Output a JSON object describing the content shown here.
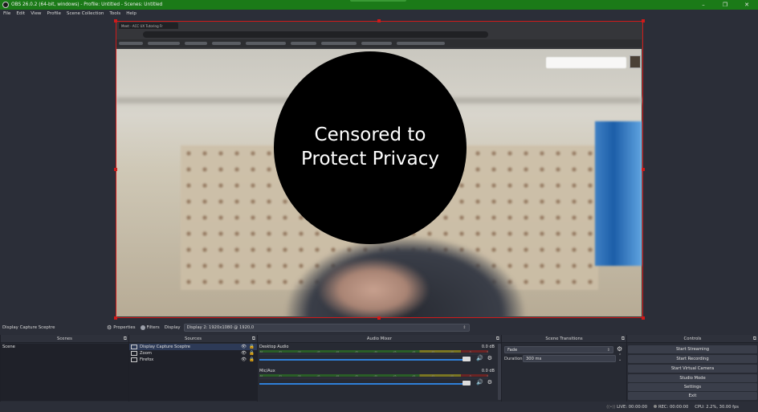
{
  "window": {
    "title": "OBS 26.0.2 (64-bit, windows) - Profile: Untitled - Scenes: Untitled",
    "minimize": "–",
    "maximize": "❐",
    "close": "✕"
  },
  "menu": [
    "File",
    "Edit",
    "View",
    "Profile",
    "Scene Collection",
    "Tools",
    "Help"
  ],
  "preview": {
    "browser_tab": "Meet - ACC UX Tutoring Fr",
    "censor_line1": "Censored to",
    "censor_line2": "Protect Privacy"
  },
  "source_bar": {
    "selected_source": "Display Capture Sceptre",
    "properties_label": "Properties",
    "filters_label": "Filters",
    "display_label": "Display",
    "display_value": "Display 2: 1920x1080 @ 1920,0"
  },
  "scenes": {
    "header": "Scenes",
    "items": [
      "Scene"
    ]
  },
  "sources": {
    "header": "Sources",
    "items": [
      "Display Capture Sceptre",
      "Zoom",
      "Firefox"
    ]
  },
  "audio_mixer": {
    "header": "Audio Mixer",
    "channels": [
      {
        "name": "Desktop Audio",
        "db": "0.0 dB"
      },
      {
        "name": "Mic/Aux",
        "db": "0.0 dB"
      }
    ],
    "scale": [
      "-60",
      "-55",
      "-50",
      "-45",
      "-40",
      "-35",
      "-30",
      "-25",
      "-20",
      "-15",
      "-10",
      "-5",
      "0"
    ]
  },
  "transitions": {
    "header": "Scene Transitions",
    "type": "Fade",
    "duration_label": "Duration",
    "duration_value": "300 ms"
  },
  "controls": {
    "header": "Controls",
    "buttons": [
      "Start Streaming",
      "Start Recording",
      "Start Virtual Camera",
      "Studio Mode",
      "Settings",
      "Exit"
    ]
  },
  "status": {
    "live": "LIVE: 00:00:00",
    "rec": "REC: 00:00:00",
    "cpu": "CPU: 2.2%, 30.00 fps"
  },
  "colors": {
    "titlebar": "#1b7a18",
    "selection_border": "#d01a1a",
    "volume_slider": "#2f7fd8",
    "panel_bg": "#272a33"
  }
}
